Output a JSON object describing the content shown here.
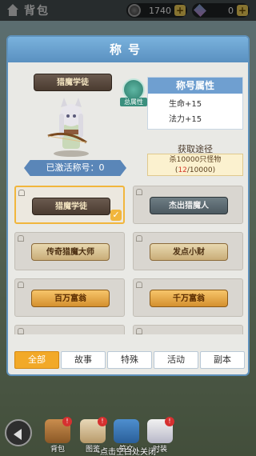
{
  "topbar": {
    "title": "背包",
    "coins": "1740",
    "gems": "0"
  },
  "modal": {
    "title": "称号",
    "current_title": "猎魔学徒",
    "activated": "已激活称号：0",
    "attr": {
      "badge": "总属性",
      "header": "称号属性",
      "lines": [
        "生命+15",
        "法力+15"
      ]
    },
    "source": {
      "title": "获取途径",
      "desc": "杀10000只怪物",
      "progress_current": "12",
      "progress_total": "/10000"
    }
  },
  "titles": [
    {
      "label": "猎魔学徒",
      "style": "brown",
      "selected": true
    },
    {
      "label": "杰出猎魔人",
      "style": "gray",
      "selected": false
    },
    {
      "label": "传奇猎魔大师",
      "style": "tan",
      "selected": false
    },
    {
      "label": "发点小财",
      "style": "tan",
      "selected": false
    },
    {
      "label": "百万富翁",
      "style": "gold",
      "selected": false
    },
    {
      "label": "千万富翁",
      "style": "gold",
      "selected": false
    },
    {
      "label": "",
      "style": "red",
      "selected": false
    },
    {
      "label": "",
      "style": "gold",
      "selected": false
    }
  ],
  "tabs": [
    "全部",
    "故事",
    "特殊",
    "活动",
    "副本"
  ],
  "bottom_nav": {
    "items": [
      {
        "label": "背包",
        "badge": "!"
      },
      {
        "label": "图鉴",
        "badge": "!"
      },
      {
        "label": "符文",
        "badge": ""
      },
      {
        "label": "时装",
        "badge": "!"
      }
    ],
    "close_hint": "点击空白处关闭"
  }
}
